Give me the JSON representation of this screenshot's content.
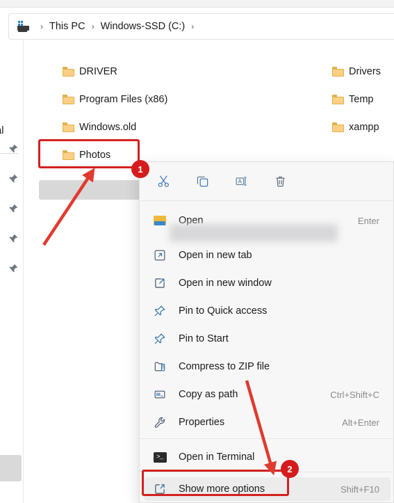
{
  "window": {
    "breadcrumb": {
      "computer_icon": "this-pc-icon",
      "separator": "›",
      "items": [
        "This PC",
        "Windows-SSD (C:)"
      ],
      "trailing_separator": "›"
    }
  },
  "nav_pane": {
    "truncated_label": "onal",
    "pin_icon": "pin-icon",
    "pin_count": 5
  },
  "files": {
    "left_column": [
      "DRIVER",
      "Program Files (x86)",
      "Windows.old",
      "Photos"
    ],
    "right_column": [
      "Drivers",
      "Temp",
      "xampp"
    ],
    "selected": "Photos"
  },
  "context_menu": {
    "toolbar": [
      {
        "name": "cut",
        "icon": "scissors-icon",
        "label": "Cut"
      },
      {
        "name": "copy",
        "icon": "copy-icon",
        "label": "Copy"
      },
      {
        "name": "rename",
        "icon": "rename-icon",
        "label": "Rename"
      },
      {
        "name": "delete",
        "icon": "trash-icon",
        "label": "Delete"
      }
    ],
    "items": [
      {
        "label": "Open",
        "shortcut": "Enter",
        "icon": "open-folder-icon"
      },
      {
        "label": "Open in new tab",
        "shortcut": "",
        "icon": "open-new-tab-icon"
      },
      {
        "label": "Open in new window",
        "shortcut": "",
        "icon": "open-new-window-icon"
      },
      {
        "label": "Pin to Quick access",
        "shortcut": "",
        "icon": "pin-icon"
      },
      {
        "label": "Pin to Start",
        "shortcut": "",
        "icon": "pin-icon"
      },
      {
        "label": "Compress to ZIP file",
        "shortcut": "",
        "icon": "zip-icon"
      },
      {
        "label": "Copy as path",
        "shortcut": "Ctrl+Shift+C",
        "icon": "copy-path-icon"
      },
      {
        "label": "Properties",
        "shortcut": "Alt+Enter",
        "icon": "wrench-icon"
      },
      {
        "label": "Open in Terminal",
        "shortcut": "",
        "icon": "terminal-icon"
      },
      {
        "label": "Show more options",
        "shortcut": "Shift+F10",
        "icon": "show-more-icon"
      }
    ]
  },
  "annotations": {
    "accent_color": "#d51c1c",
    "badges": [
      {
        "number": "1",
        "target": "Photos"
      },
      {
        "number": "2",
        "target": "Show more options"
      }
    ]
  }
}
